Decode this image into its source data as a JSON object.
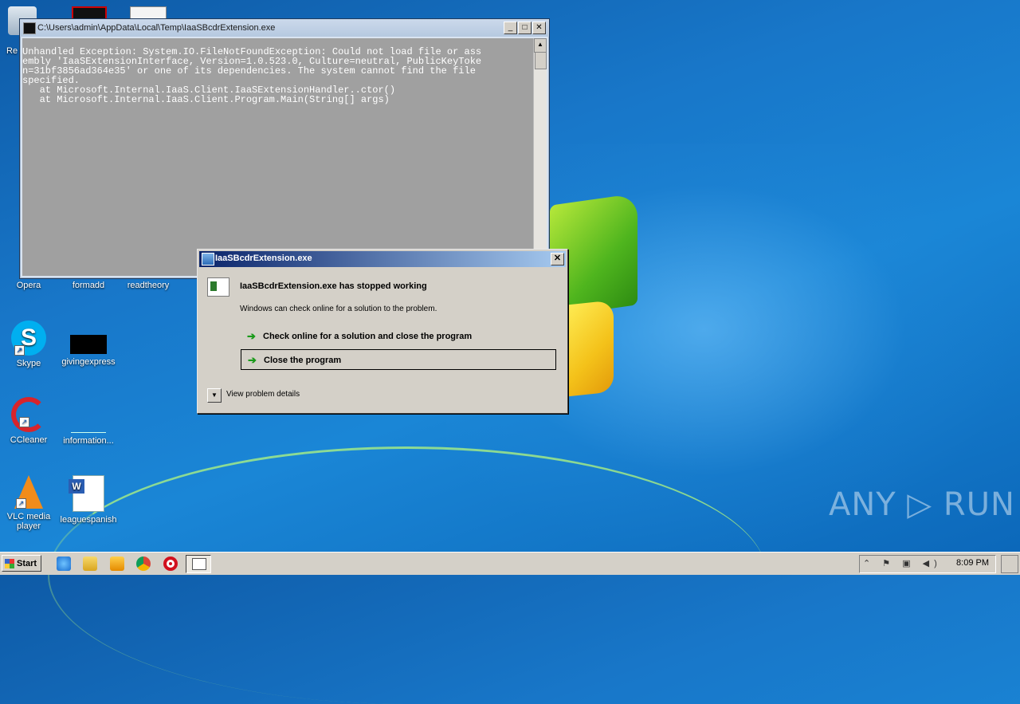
{
  "desktop": {
    "icons": [
      {
        "label": "Opera"
      },
      {
        "label": "formadd"
      },
      {
        "label": "readtheory"
      },
      {
        "label": "Skype"
      },
      {
        "label": "givingexpress"
      },
      {
        "label": "CCleaner"
      },
      {
        "label": "information..."
      },
      {
        "label": "VLC media player"
      },
      {
        "label": "leaguespanish"
      }
    ],
    "partial_labels": {
      "recycle": "Re"
    }
  },
  "console_window": {
    "title": "C:\\Users\\admin\\AppData\\Local\\Temp\\IaaSBcdrExtension.exe",
    "output": "Unhandled Exception: System.IO.FileNotFoundException: Could not load file or ass\nembly 'IaaSExtensionInterface, Version=1.0.523.0, Culture=neutral, PublicKeyToke\nn=31bf3856ad364e35' or one of its dependencies. The system cannot find the file\nspecified.\n   at Microsoft.Internal.IaaS.Client.IaaSExtensionHandler..ctor()\n   at Microsoft.Internal.IaaS.Client.Program.Main(String[] args)"
  },
  "error_dialog": {
    "title": "IaaSBcdrExtension.exe",
    "heading": "IaaSBcdrExtension.exe has stopped working",
    "subtext": "Windows can check online for a solution to the problem.",
    "option_check_online": "Check online for a solution and close the program",
    "option_close": "Close the program",
    "view_details": "View problem details"
  },
  "taskbar": {
    "start_label": "Start",
    "clock": "8:09 PM"
  },
  "watermark": "ANY ▷ RUN",
  "colors": {
    "desktop_bg": "#1877c9",
    "dialog_title_start": "#0a246a",
    "dialog_title_end": "#a6caf0",
    "console_bg": "#a0a0a0",
    "action_arrow": "#1a9a1a"
  }
}
